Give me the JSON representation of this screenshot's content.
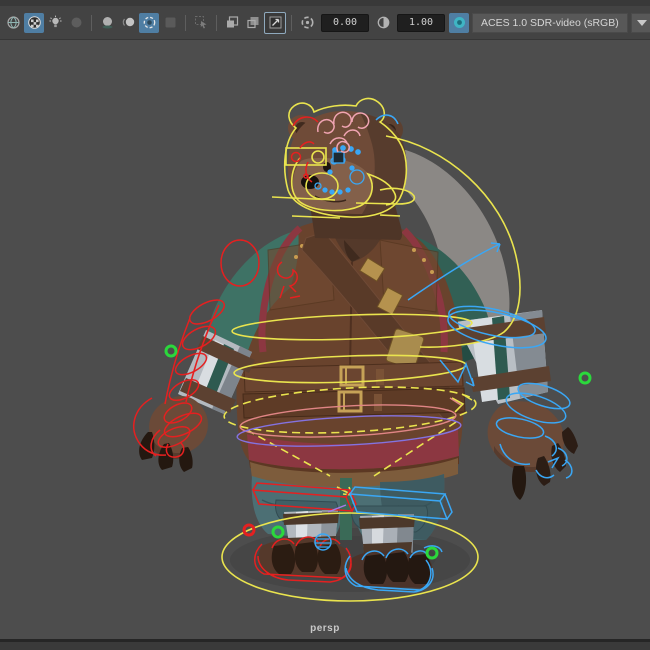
{
  "toolbar": {
    "background": "#434343",
    "active_highlight": "#4f7ea3",
    "buttons": [
      {
        "name": "shaded-display",
        "icon": "shaded-sphere-icon",
        "active": false,
        "enabled": true
      },
      {
        "name": "textured-display",
        "icon": "textured-sphere-icon",
        "active": true,
        "enabled": true
      },
      {
        "name": "lighting",
        "icon": "light-bulb-icon",
        "active": false,
        "enabled": true
      },
      {
        "name": "shadows",
        "icon": "shadows-sphere-icon",
        "active": false,
        "enabled": false
      },
      {
        "name": "screen-space-ambient-occlusion",
        "icon": "occlusion-sphere-icon",
        "active": false,
        "enabled": true
      },
      {
        "name": "motion-blur",
        "icon": "motion-blur-sphere-icon",
        "active": false,
        "enabled": true
      },
      {
        "name": "anti-aliasing",
        "icon": "anti-aliasing-circle-icon",
        "active": true,
        "enabled": true
      },
      {
        "name": "depth-of-field",
        "icon": "depth-of-field-icon",
        "active": false,
        "enabled": false
      },
      {
        "name": "select-tool",
        "icon": "cursor-icon",
        "active": false,
        "enabled": false
      },
      {
        "name": "isolate-select",
        "icon": "overlap-squares-icon",
        "active": false,
        "enabled": true
      },
      {
        "name": "isolate-select-view",
        "icon": "overlap-squares-alt-icon",
        "active": false,
        "enabled": true
      },
      {
        "name": "image-plane",
        "icon": "image-plane-icon",
        "active": true,
        "enabled": true
      }
    ],
    "exposure": {
      "icon": "exposure-icon",
      "value": "0.00"
    },
    "gamma": {
      "icon": "gamma-icon",
      "value": "1.00"
    },
    "color_management": {
      "icon": "color-management-icon",
      "view_transform": "ACES 1.0 SDR-video (sRGB)"
    }
  },
  "viewport": {
    "camera_label": "persp",
    "background": "#4d4d4d",
    "scene": {
      "subject": "bear-character-with-animation-rig",
      "rig_colors": {
        "primary_controls": "#eae44e",
        "left_side_controls": "#e52020",
        "right_side_controls": "#3aa7f5",
        "hair_curves": "#f0a4b2",
        "secondary_purple": "#8472e0",
        "secondary_pink": "#e08585",
        "key_markers_green": "#2bd83c"
      }
    }
  }
}
